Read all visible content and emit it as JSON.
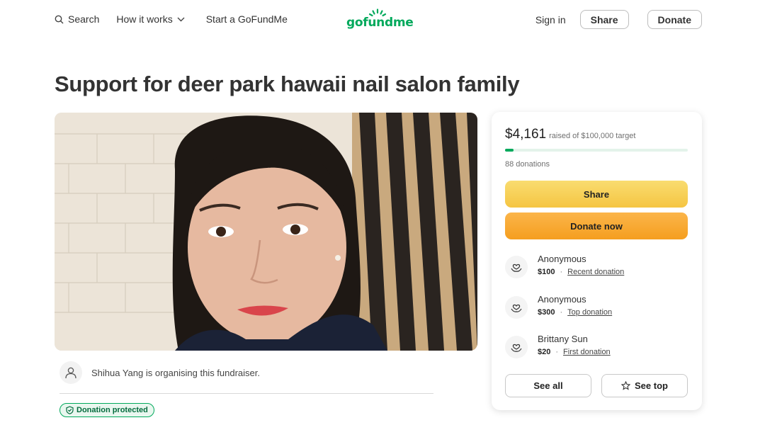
{
  "header": {
    "search_label": "Search",
    "how_it_works_label": "How it works",
    "start_label": "Start a GoFundMe",
    "logo_text": "gofundme",
    "sign_in_label": "Sign in",
    "share_label": "Share",
    "donate_label": "Donate"
  },
  "campaign": {
    "title": "Support for deer park hawaii nail salon family",
    "organiser_text": "Shihua Yang is organising this fundraiser.",
    "protected_label": "Donation protected"
  },
  "card": {
    "raised_amount": "$4,161",
    "raised_target": "raised of $100,000 target",
    "progress_fraction": 0.0416,
    "donations_count": "88 donations",
    "share_label": "Share",
    "donate_now_label": "Donate now",
    "donors": [
      {
        "name": "Anonymous",
        "amount": "$100",
        "tag": "Recent donation"
      },
      {
        "name": "Anonymous",
        "amount": "$300",
        "tag": "Top donation"
      },
      {
        "name": "Brittany Sun",
        "amount": "$20",
        "tag": "First donation"
      }
    ],
    "see_all_label": "See all",
    "see_top_label": "See top"
  },
  "colors": {
    "brand_green": "#02a95c",
    "share_yellow": "#f5c542",
    "donate_orange": "#f59e1f"
  },
  "icons": {
    "search": "search-icon",
    "chevron": "chevron-down-icon",
    "user": "user-icon",
    "shield": "shield-icon",
    "heart_hand": "heart-hand-icon",
    "star": "star-icon"
  }
}
